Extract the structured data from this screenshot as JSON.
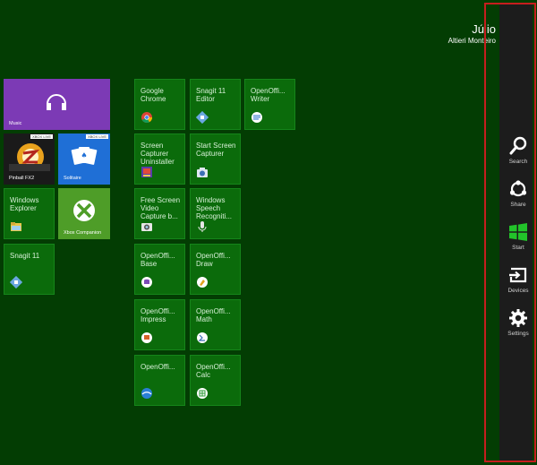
{
  "user": {
    "first_name": "Júlio",
    "last_name": "Altieri Monteiro"
  },
  "tiles": {
    "music": {
      "label": "Music",
      "color": "#7c3ab5"
    },
    "pinball": {
      "label": "Pinball FX2",
      "badge": "XBOX LIVE",
      "color": "#1a1a1a"
    },
    "solitaire": {
      "label": "Solitaire",
      "badge": "XBOX LIVE",
      "color": "#1f6fd6"
    },
    "windows_explorer": {
      "label": "Windows Explorer"
    },
    "xbox_companion": {
      "label": "Xbox Companion",
      "color": "#4e9d28"
    },
    "snagit": {
      "label": "Snagit 11"
    }
  },
  "apps": {
    "google_chrome": "Google Chrome",
    "snagit_editor": "Snagit 11 Editor",
    "openoffice_writer": "OpenOffi... Writer",
    "screen_capturer_uninstaller": "Screen Capturer Uninstaller",
    "start_screen_capturer": "Start Screen Capturer",
    "free_screen_video": "Free Screen Video Capture b...",
    "windows_speech": "Windows Speech Recogniti...",
    "openoffice_base": "OpenOffi... Base",
    "openoffice_draw": "OpenOffi... Draw",
    "openoffice_impress": "OpenOffi... Impress",
    "openoffice_math": "OpenOffi... Math",
    "openoffice": "OpenOffi...",
    "openoffice_calc": "OpenOffi... Calc"
  },
  "charms": {
    "search": "Search",
    "share": "Share",
    "start": "Start",
    "devices": "Devices",
    "settings": "Settings"
  },
  "colors": {
    "background": "#033d03",
    "tile_green": "#0b6b0b",
    "charm_bar": "#1c1c1c",
    "highlight": "#c61e1e",
    "start_icon": "#22c32a"
  }
}
